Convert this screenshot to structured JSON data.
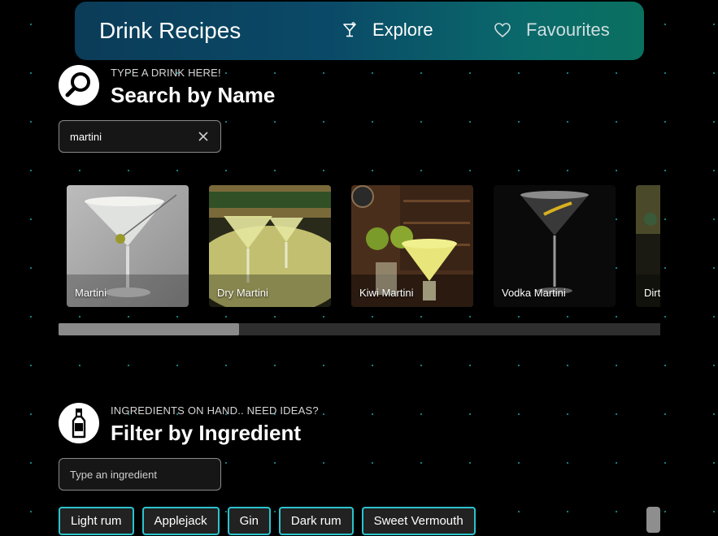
{
  "app": {
    "title": "Drink Recipes"
  },
  "nav": {
    "explore_label": "Explore",
    "favourites_label": "Favourites",
    "explore_icon": "cocktail-glass-icon",
    "favourites_icon": "heart-icon"
  },
  "search": {
    "kicker": "TYPE A DRINK HERE!",
    "title": "Search by Name",
    "value": "martini",
    "icon": "magnifier-icon",
    "results": [
      {
        "name": "Martini"
      },
      {
        "name": "Dry Martini"
      },
      {
        "name": "Kiwi Martini"
      },
      {
        "name": "Vodka Martini"
      },
      {
        "name": "Dirty Martini"
      }
    ],
    "scroll_fraction_visible": 0.3
  },
  "ingredient": {
    "kicker": "INGREDIENTS ON HAND.. NEED IDEAS?",
    "title": "Filter by Ingredient",
    "placeholder": "Type an ingredient",
    "icon": "bottle-icon",
    "chips": [
      "Light rum",
      "Applejack",
      "Gin",
      "Dark rum",
      "Sweet Vermouth"
    ]
  },
  "colors": {
    "accent": "#2bc4cf",
    "nav_gradient_start": "#0b3c58",
    "nav_gradient_end": "#0a7060"
  }
}
